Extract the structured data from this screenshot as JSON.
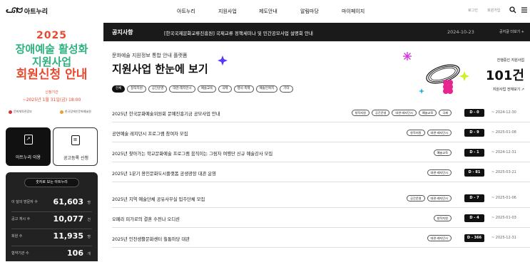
{
  "header": {
    "logo_mark": "ᓚᘏᗢ",
    "logo_text": "아트누리",
    "nav": [
      "아트누리",
      "지원사업",
      "제도안내",
      "알림마당",
      "마이페이지"
    ],
    "login": "로그인",
    "signup": "회원가입"
  },
  "promo": {
    "year": "2025",
    "line1": "장애예술 활성화",
    "line2": "지원사업",
    "line3": "회원신청 안내",
    "period_label": "신청기간",
    "period_value": "~2025년 1월 31일(금) 18:00",
    "org1": "문화체육관광부",
    "org2": "한국장애인문화예술원"
  },
  "quick": {
    "btn1_label": "아트누리 이용",
    "btn2_label": "공고등록 신청"
  },
  "stats": {
    "title": "숫자로 보는 아트누리",
    "rows": [
      {
        "label": "이 달의 방문자 수",
        "value": "61,603",
        "unit": "명"
      },
      {
        "label": "공고 게시 수",
        "value": "10,077",
        "unit": "건"
      },
      {
        "label": "회원 수",
        "value": "11,935",
        "unit": "명"
      },
      {
        "label": "협약기관 수",
        "value": "106",
        "unit": "개"
      }
    ]
  },
  "notice": {
    "label": "공지사항",
    "text": "[한국국제문화교류진흥원] 국제교류 정책세미나 및 민간공모사업 설명회 안내",
    "date": "2024-10-23",
    "more": "공지글 더보기 +"
  },
  "hero": {
    "subtitle": "문화예술 지원정보 통합 안내 플랫폼",
    "title": "지원사업 한눈에 보기",
    "progress_label": "진행중인 지원사업",
    "progress_value": "101건",
    "progress_more": "지원사업 전체보기 ↗"
  },
  "chips": [
    "전체",
    "창작지원",
    "공간운영",
    "대관·레지던시",
    "예술교육",
    "국제",
    "행사·축제",
    "예술인복지",
    "기타"
  ],
  "items": [
    {
      "title": "2025년 한국문화예술위원회 문예진흥기금 공모사업 안내",
      "tags": [
        "창작지원",
        "공간운영",
        "대관·레지던시",
        "예술교육",
        "국제"
      ],
      "dday": "D - 0",
      "date": "~ 2024-12-30"
    },
    {
      "title": "공연예술 레지던시 프로그램 참여자 모집",
      "tags": [
        "창작지원",
        "대관·레지던시"
      ],
      "dday": "D - 9",
      "date": "~ 2025-01-08"
    },
    {
      "title": "2025년 찾아가는 학교문화예술 프로그램 움직이는 그림자 여행단 신규 예술강사 모집",
      "tags": [
        "예술교육"
      ],
      "dday": "D - 1",
      "date": "~ 2024-12-31"
    },
    {
      "title": "2025년 1분기 용인문화도시플랫폼 공생광장 대관 운영",
      "tags": [
        "대관·레지던시"
      ],
      "dday": "D - 81",
      "date": "~ 2025-03-21"
    },
    {
      "title": "2025년 지역 예술단체 공유사무실 입주단체 모집",
      "tags": [
        "공간운영",
        "대관·레지던시"
      ],
      "dday": "D - 7",
      "date": "~ 2025-01-06"
    },
    {
      "title": "오페라 피가로의 결혼 수전나 오디션",
      "tags": [
        "창작지원"
      ],
      "dday": "D - 4",
      "date": "~ 2025-01-03"
    },
    {
      "title": "2025년 인천생활문화센터 칠통마당 대관",
      "tags": [
        "대관·레지던시"
      ],
      "dday": "D - 366",
      "date": "~ 2025-12-31"
    }
  ]
}
